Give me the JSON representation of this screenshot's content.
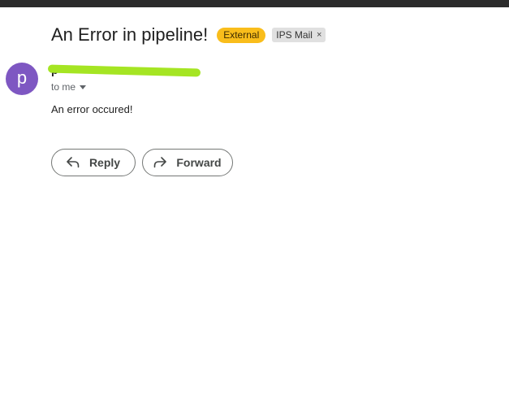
{
  "email": {
    "subject": "An Error in pipeline!",
    "labels": [
      {
        "text": "External",
        "color": "#f9bd1b"
      },
      {
        "text": "IPS Mail",
        "remove_icon": "×"
      }
    ],
    "sender": {
      "avatar_letter": "p",
      "avatar_color": "#7e57c2",
      "name": "p"
    },
    "recipient": "to me",
    "body": "An error occured!"
  },
  "actions": {
    "reply_label": "Reply",
    "reply_icon": "reply-arrow-icon",
    "forward_label": "Forward",
    "forward_icon": "forward-arrow-icon"
  }
}
